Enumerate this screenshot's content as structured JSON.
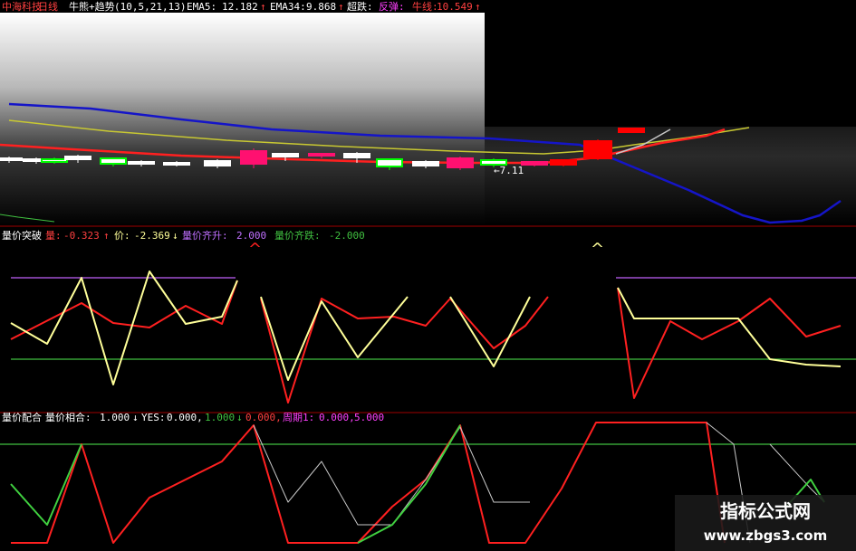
{
  "header": {
    "stock_name": "中海科技",
    "period": "日线",
    "indicator": "牛熊+趋势",
    "params": "(10,5,21,13)",
    "ema5_label": "EMA5:",
    "ema5_value": "12.182",
    "ema5_arrow": "↑",
    "ema34_label": "EMA34:",
    "ema34_value": "9.868",
    "ema34_arrow": "↑",
    "oversold_label": "超跌:",
    "rebound_label": "反弹:",
    "bull_label": "牛线:",
    "bull_value": "10.549",
    "bull_arrow": "↑"
  },
  "panel2": {
    "title": "量价突破",
    "vol_label": "量:",
    "vol_value": "-0.323",
    "vol_arrow": "↑",
    "price_label": "价:",
    "price_value": "-2.369",
    "price_arrow": "↓",
    "rise_label": "量价齐升:",
    "rise_value": "2.000",
    "fall_label": "量价齐跌:",
    "fall_value": "-2.000"
  },
  "panel3": {
    "title": "量价配合",
    "match_label": "量价相合:",
    "match_value": "1.000",
    "match_arrow": "↓",
    "yes_label": "YES:",
    "yes_value": "0.000,",
    "v2": "1.000",
    "v2_arrow": "↓",
    "v3": "0.000,",
    "cycle_label": "周期1:",
    "cycle_value": "0.000,",
    "v4": "5.000"
  },
  "annotations": {
    "low_marker": "←7.11",
    "rise_marker_1": "^",
    "rise_marker_2": "^"
  },
  "watermark": {
    "title": "指标公式网",
    "url": "www.zbgs3.com"
  },
  "colors": {
    "background": "#000000",
    "up_candle": "#ff0000",
    "down_candle": "#00ff00",
    "ema5": "#ff2020",
    "ema34": "#c8c832",
    "trend_blue": "#1515c8",
    "white_line": "#c8c8c8",
    "yellow_line": "#ffff99",
    "purple_level": "#a050d0",
    "green_level": "#40c040",
    "magenta_text": "#ff40ff",
    "panel_divider": "#a00000"
  },
  "chart_data": [
    {
      "type": "candlestick",
      "title": "中海科技 日线 牛熊+趋势(10,5,21,13)",
      "series": [
        {
          "name": "EMA5",
          "value": 12.182
        },
        {
          "name": "EMA34",
          "value": 9.868
        },
        {
          "name": "牛线",
          "value": 10.549
        }
      ],
      "annotations": [
        {
          "text": "←7.11",
          "value": 7.11
        }
      ]
    },
    {
      "type": "line",
      "title": "量价突破",
      "series": [
        {
          "name": "量",
          "value": -0.323
        },
        {
          "name": "价",
          "value": -2.369
        },
        {
          "name": "量价齐升",
          "value": 2.0
        },
        {
          "name": "量价齐跌",
          "value": -2.0
        }
      ]
    },
    {
      "type": "line",
      "title": "量价配合",
      "series": [
        {
          "name": "量价相合",
          "value": 1.0
        },
        {
          "name": "YES",
          "value": 0.0
        },
        {
          "name": "周期1",
          "value": 0.0
        }
      ]
    }
  ]
}
